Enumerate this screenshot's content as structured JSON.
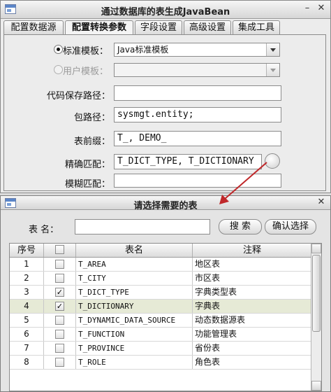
{
  "main": {
    "title": "通过数据库的表生成JavaBean",
    "minimize": "–",
    "close": "✕",
    "tabs": [
      "配置数据源",
      "配置转换参数",
      "字段设置",
      "高级设置",
      "集成工具"
    ],
    "active_tab": "配置转换参数",
    "form": {
      "standard_template_label": "标准模板：",
      "standard_template_value": "Java标准模板",
      "user_template_label": "用户模板：",
      "user_template_value": "",
      "code_path_label": "代码保存路径：",
      "code_path_value": "",
      "package_label": "包路径：",
      "package_value": "sysmgt.entity;",
      "prefix_label": "表前缀：",
      "prefix_value": "T_, DEMO_",
      "exact_label": "精确匹配：",
      "exact_value": "T_DICT_TYPE, T_DICTIONARY",
      "fuzzy_label": "模糊匹配：",
      "fuzzy_value": ""
    }
  },
  "dialog": {
    "title": "请选择需要的表",
    "close": "✕",
    "table_name_label": "表  名：",
    "table_name_value": "",
    "search_button": "搜 索",
    "confirm_button": "确认选择",
    "columns": [
      "序号",
      "",
      "表名",
      "注释"
    ],
    "rows": [
      {
        "no": "1",
        "checked": false,
        "name": "T_AREA",
        "comment": "地区表"
      },
      {
        "no": "2",
        "checked": false,
        "name": "T_CITY",
        "comment": "市区表"
      },
      {
        "no": "3",
        "checked": true,
        "name": "T_DICT_TYPE",
        "comment": "字典类型表"
      },
      {
        "no": "4",
        "checked": true,
        "name": "T_DICTIONARY",
        "comment": "字典表",
        "selected": true
      },
      {
        "no": "5",
        "checked": false,
        "name": "T_DYNAMIC_DATA_SOURCE",
        "comment": "动态数据源表"
      },
      {
        "no": "6",
        "checked": false,
        "name": "T_FUNCTION",
        "comment": "功能管理表"
      },
      {
        "no": "7",
        "checked": false,
        "name": "T_PROVINCE",
        "comment": "省份表"
      },
      {
        "no": "8",
        "checked": false,
        "name": "T_ROLE",
        "comment": "角色表"
      }
    ]
  },
  "colors": {
    "selected_row": "#e6ead6",
    "arrow": "#c0282a"
  }
}
